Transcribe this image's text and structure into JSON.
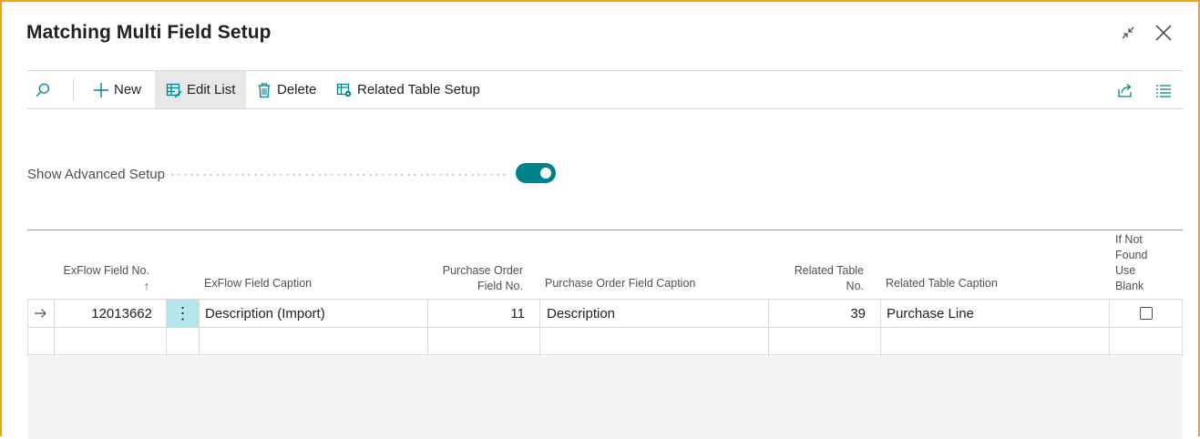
{
  "window": {
    "title": "Matching Multi Field Setup",
    "accent": "#f0a30a"
  },
  "actions": {
    "new_label": "New",
    "edit_list_label": "Edit List",
    "delete_label": "Delete",
    "related_table_setup_label": "Related Table Setup"
  },
  "settings": {
    "show_advanced_setup_label": "Show Advanced Setup",
    "show_advanced_setup_on": true,
    "toggle_color": "#00828c"
  },
  "table": {
    "columns": {
      "exflow_field_no": "ExFlow Field No.",
      "sort_indicator": "↑",
      "exflow_field_caption": "ExFlow Field Caption",
      "purchase_order_field_no_line1": "Purchase Order",
      "purchase_order_field_no_line2": "Field No.",
      "purchase_order_field_caption": "Purchase Order Field Caption",
      "related_table_no_line1": "Related Table",
      "related_table_no_line2": "No.",
      "related_table_caption": "Related Table Caption",
      "if_not_found_line1": "If Not",
      "if_not_found_line2": "Found",
      "if_not_found_line3": "Use",
      "if_not_found_line4": "Blank"
    },
    "rows": [
      {
        "exflow_field_no": "12013662",
        "exflow_field_caption": "Description (Import)",
        "purchase_order_field_no": "11",
        "purchase_order_field_caption": "Description",
        "related_table_no": "39",
        "related_table_caption": "Purchase Line",
        "if_not_found_use_blank": false
      }
    ],
    "row_menu_glyph": "⋮",
    "selected_cell_color": "#b3e7ea"
  }
}
